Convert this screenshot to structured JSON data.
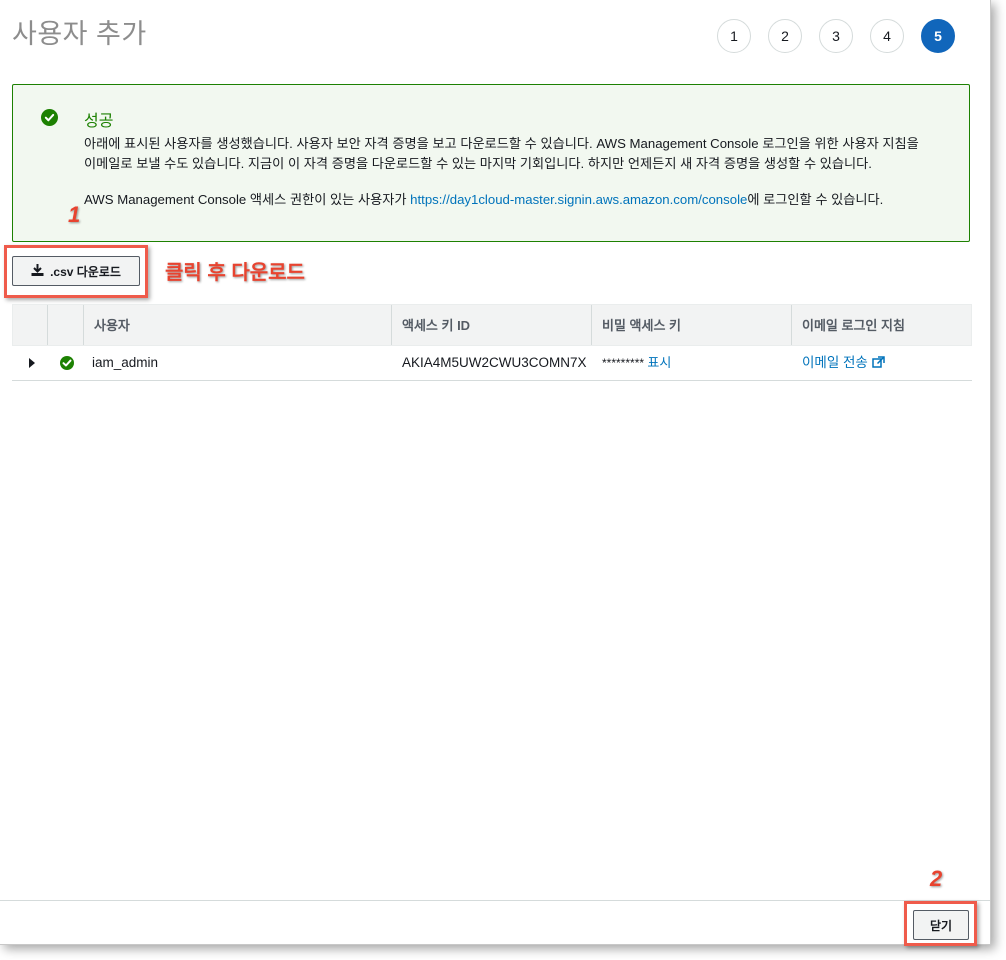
{
  "page_title": "사용자 추가",
  "steps": [
    "1",
    "2",
    "3",
    "4",
    "5"
  ],
  "current_step": "5",
  "alert": {
    "title": "성공",
    "line1": "아래에 표시된 사용자를 생성했습니다. 사용자 보안 자격 증명을 보고 다운로드할 수 있습니다. AWS Management Console 로그인을 위한 사용자 지침을",
    "line2": "이메일로 보낼 수도 있습니다. 지금이 이 자격 증명을 다운로드할 수 있는 마지막 기회입니다. 하지만 언제든지 새 자격 증명을 생성할 수 있습니다.",
    "line3_prefix": "AWS Management Console 액세스 권한이 있는 사용자가 ",
    "line3_link": "https://day1cloud-master.signin.aws.amazon.com/console",
    "line3_suffix": "에 로그인할 수 있습니다."
  },
  "csv_button_label": ".csv 다운로드",
  "annotations": {
    "num1": "1",
    "num2": "2",
    "hint": "클릭 후 다운로드"
  },
  "table": {
    "headers": [
      "사용자",
      "액세스 키 ID",
      "비밀 액세스 키",
      "이메일 로그인 지침"
    ],
    "rows": [
      {
        "user": "iam_admin",
        "access_key_id": "AKIA4M5UW2CWU3COMN7X",
        "secret_masked": "*********",
        "secret_show": "표시",
        "email_link": "이메일 전송"
      }
    ]
  },
  "close_button_label": "닫기",
  "colors": {
    "success": "#1d8102",
    "link": "#0073bb",
    "active_step": "#1166bb",
    "annotation": "#e8432f"
  }
}
